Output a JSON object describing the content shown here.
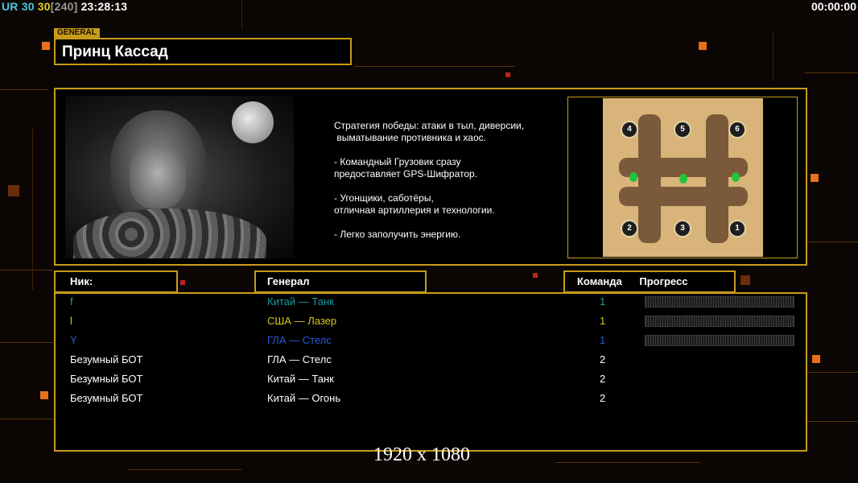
{
  "hud": {
    "left_tag": "UR",
    "left_num1": "30",
    "left_num2": "30",
    "left_bracket": "[240]",
    "clock": "23:28:13",
    "timer": "00:00:00"
  },
  "general": {
    "tag": "GENERAL",
    "name": "Принц Кассад",
    "description": "Стратегия победы: атаки в тыл, диверсии,\n выматывание противника и хаос.\n\n- Командный Грузовик сразу\nпредоставляет GPS-Шифратор.\n\n- Угонщики, саботёры,\nотличная артиллерия и технологии.\n\n- Легко заполучить энергию."
  },
  "map": {
    "slots": [
      "4",
      "5",
      "6",
      "2",
      "3",
      "1"
    ]
  },
  "table": {
    "headers": {
      "nick": "Ник:",
      "general": "Генерал",
      "team": "Команда",
      "progress": "Прогресс"
    },
    "rows": [
      {
        "nick": "f",
        "general": "Китай — Танк",
        "team": "1",
        "color": "#1a9aa0",
        "show_progress": true
      },
      {
        "nick": "l",
        "general": "США — Лазер",
        "team": "1",
        "color": "#d8c818",
        "show_progress": true
      },
      {
        "nick": "Y",
        "general": "ГЛА — Стелс",
        "team": "1",
        "color": "#2a5ad8",
        "show_progress": true
      },
      {
        "nick": "Безумный БОТ",
        "general": "ГЛА — Стелс",
        "team": "2",
        "color": "#ffffff",
        "show_progress": false
      },
      {
        "nick": "Безумный БОТ",
        "general": "Китай — Танк",
        "team": "2",
        "color": "#ffffff",
        "show_progress": false
      },
      {
        "nick": "Безумный БОТ",
        "general": "Китай — Огонь",
        "team": "2",
        "color": "#ffffff",
        "show_progress": false
      }
    ]
  },
  "colors": {
    "frame": "#c89c1a",
    "hud_ur": "#4ac8e0",
    "hud_num1": "#4ac8e0",
    "hud_num2": "#e8d020",
    "hud_bracket": "#9a9a9a"
  },
  "watermark": "1920 x 1080"
}
